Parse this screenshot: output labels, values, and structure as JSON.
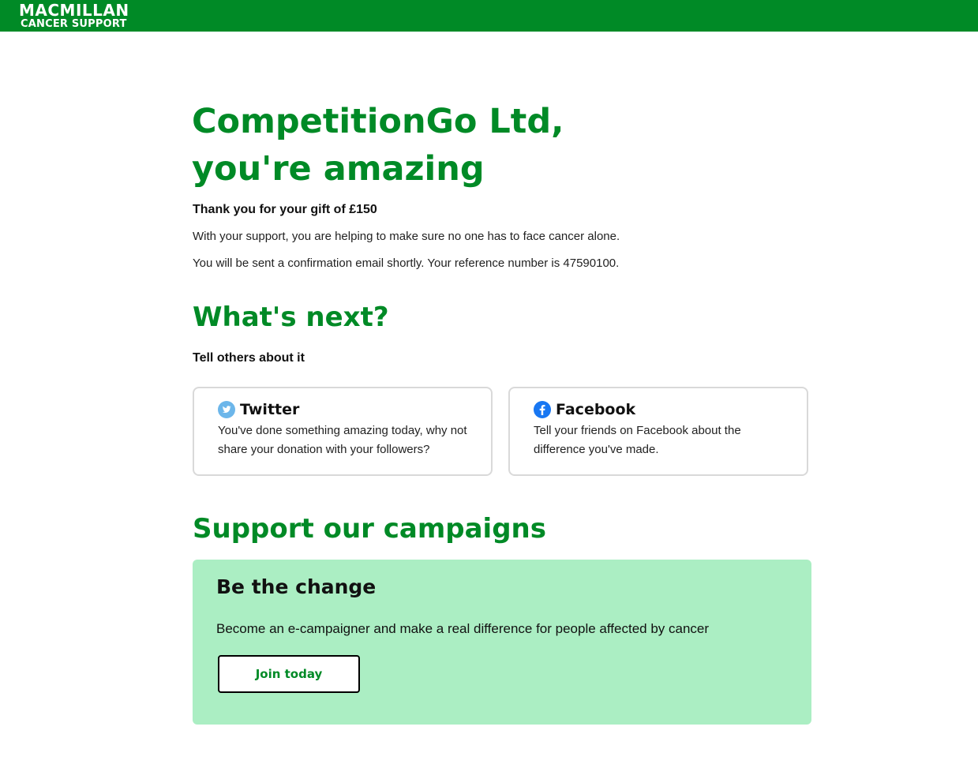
{
  "brand": {
    "line1": "MACMILLAN",
    "line2": "CANCER SUPPORT",
    "color": "#008a26"
  },
  "thanks": {
    "heading_line1": "CompetitionGo Ltd,",
    "heading_line2": "you're amazing",
    "gift": "Thank you for your gift of £150",
    "support": "With your support, you are helping to make sure no one has to face cancer alone.",
    "confirmation": "You will be sent a confirmation email shortly. Your reference number is 47590100."
  },
  "next": {
    "heading": "What's next?",
    "subheading": "Tell others about it",
    "cards": [
      {
        "icon": "twitter-icon",
        "title": "Twitter",
        "body": "You've done something amazing today, why not share your donation with your followers?"
      },
      {
        "icon": "facebook-icon",
        "title": "Facebook",
        "body": "Tell your friends on Facebook about the difference you've made."
      }
    ]
  },
  "campaigns": {
    "heading": "Support our campaigns",
    "panel_title": "Be the change",
    "panel_text": "Become an e-campaigner and make a real difference for people affected by cancer",
    "button_label": "Join today",
    "panel_color": "#abeec3"
  }
}
